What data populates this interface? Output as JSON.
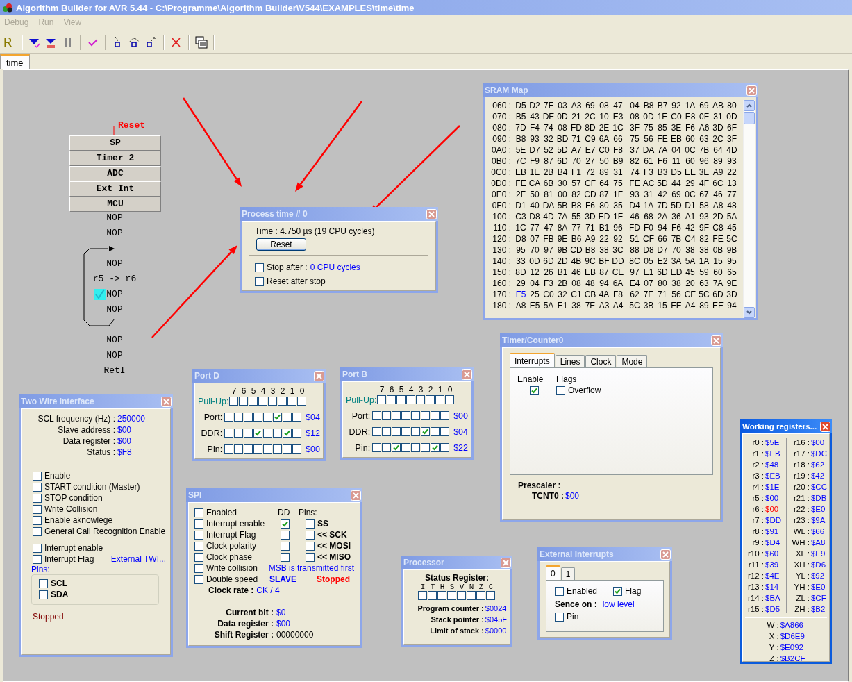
{
  "window": {
    "title": "Algorithm Builder for AVR 5.44 - C:\\Programme\\Algorithm Builder\\V544\\EXAMPLES\\time\\time"
  },
  "menu": [
    {
      "label": "Debug",
      "disabled": true
    },
    {
      "label": "Run",
      "disabled": true
    },
    {
      "label": "View",
      "disabled": true
    }
  ],
  "toolbar": {
    "logo": "R"
  },
  "tabs": [
    {
      "label": "time",
      "selected": true
    }
  ],
  "flowchart": {
    "start": "Reset",
    "blocks": [
      "SP",
      "Timer 2",
      "ADC",
      "Ext Int",
      "MCU"
    ],
    "nodes": [
      {
        "text": "NOP",
        "marked": false
      },
      {
        "text": "NOP",
        "marked": false
      },
      {
        "text": "NOP",
        "marked": false
      },
      {
        "text": "r5 -> r6",
        "marked": false
      },
      {
        "text": "NOP",
        "marked": true
      },
      {
        "text": "NOP",
        "marked": false
      },
      {
        "text": "NOP",
        "marked": false
      },
      {
        "text": "NOP",
        "marked": false
      },
      {
        "text": "RetI",
        "marked": false
      }
    ]
  },
  "process_time": {
    "title": "Process time # 0",
    "active": false,
    "time": "Time :  4.750 µs (19 CPU cycles)",
    "reset_button": "Reset",
    "options": [
      {
        "label": "Stop after :",
        "link": "0 CPU cycles",
        "checked": false
      },
      {
        "label": "Reset after stop",
        "checked": false
      }
    ]
  },
  "sram_map": {
    "title": "SRAM Map",
    "active": false,
    "rows": [
      {
        "address": "060 :",
        "bytes": [
          "D5",
          "D2",
          "7F",
          "03",
          "A3",
          "69",
          "08",
          "47",
          "04",
          "B8",
          "B7",
          "92",
          "1A",
          "69",
          "AB",
          "80"
        ]
      },
      {
        "address": "070 :",
        "bytes": [
          "B5",
          "43",
          "DE",
          "0D",
          "21",
          "2C",
          "10",
          "E3",
          "08",
          "0D",
          "1E",
          "C0",
          "E8",
          "0F",
          "31",
          "0D"
        ]
      },
      {
        "address": "080 :",
        "bytes": [
          "7D",
          "F4",
          "74",
          "08",
          "FD",
          "8D",
          "2E",
          "1C",
          "3F",
          "75",
          "85",
          "3E",
          "F6",
          "A6",
          "3D",
          "6F"
        ]
      },
      {
        "address": "090 :",
        "bytes": [
          "B8",
          "93",
          "32",
          "BD",
          "71",
          "C9",
          "6A",
          "66",
          "75",
          "56",
          "FE",
          "EB",
          "60",
          "63",
          "2C",
          "3F"
        ]
      },
      {
        "address": "0A0 :",
        "bytes": [
          "5E",
          "D7",
          "52",
          "5D",
          "A7",
          "E7",
          "C0",
          "F8",
          "37",
          "DA",
          "7A",
          "04",
          "0C",
          "7B",
          "64",
          "4D"
        ]
      },
      {
        "address": "0B0 :",
        "bytes": [
          "7C",
          "F9",
          "87",
          "6D",
          "70",
          "27",
          "50",
          "B9",
          "82",
          "61",
          "F6",
          "11",
          "60",
          "96",
          "89",
          "93"
        ]
      },
      {
        "address": "0C0 :",
        "bytes": [
          "EB",
          "1E",
          "2B",
          "B4",
          "F1",
          "72",
          "89",
          "31",
          "74",
          "F3",
          "B3",
          "D5",
          "EE",
          "3E",
          "A9",
          "22"
        ]
      },
      {
        "address": "0D0 :",
        "bytes": [
          "FE",
          "CA",
          "6B",
          "30",
          "57",
          "CF",
          "64",
          "75",
          "FE",
          "AC",
          "5D",
          "44",
          "29",
          "4F",
          "6C",
          "13"
        ]
      },
      {
        "address": "0E0 :",
        "bytes": [
          "2F",
          "50",
          "81",
          "00",
          "82",
          "CD",
          "87",
          "1F",
          "93",
          "31",
          "42",
          "69",
          "0C",
          "67",
          "46",
          "77"
        ]
      },
      {
        "address": "0F0 :",
        "bytes": [
          "D1",
          "40",
          "DA",
          "5B",
          "B8",
          "F6",
          "80",
          "35",
          "D4",
          "1A",
          "7D",
          "5D",
          "D1",
          "58",
          "A8",
          "48"
        ]
      },
      {
        "address": "100 :",
        "bytes": [
          "C3",
          "D8",
          "4D",
          "7A",
          "55",
          "3D",
          "ED",
          "1F",
          "46",
          "68",
          "2A",
          "36",
          "A1",
          "93",
          "2D",
          "5A"
        ]
      },
      {
        "address": "110 :",
        "bytes": [
          "1C",
          "77",
          "47",
          "8A",
          "77",
          "71",
          "B1",
          "96",
          "FD",
          "F0",
          "94",
          "F6",
          "42",
          "9F",
          "C8",
          "45"
        ]
      },
      {
        "address": "120 :",
        "bytes": [
          "D8",
          "07",
          "FB",
          "9E",
          "B6",
          "A9",
          "22",
          "92",
          "51",
          "CF",
          "66",
          "7B",
          "C4",
          "82",
          "FE",
          "5C"
        ]
      },
      {
        "address": "130 :",
        "bytes": [
          "95",
          "70",
          "97",
          "9B",
          "CD",
          "B8",
          "38",
          "3C",
          "88",
          "D8",
          "D7",
          "70",
          "38",
          "38",
          "0B",
          "9B"
        ]
      },
      {
        "address": "140 :",
        "bytes": [
          "33",
          "0D",
          "6D",
          "2D",
          "4B",
          "9C",
          "BF",
          "DD",
          "8C",
          "05",
          "E2",
          "3A",
          "5A",
          "1A",
          "15",
          "95"
        ]
      },
      {
        "address": "150 :",
        "bytes": [
          "8D",
          "12",
          "26",
          "B1",
          "46",
          "EB",
          "87",
          "CE",
          "97",
          "E1",
          "6D",
          "ED",
          "45",
          "59",
          "60",
          "65"
        ]
      },
      {
        "address": "160 :",
        "bytes": [
          "29",
          "04",
          "F3",
          "2B",
          "08",
          "48",
          "94",
          "6A",
          "E4",
          "07",
          "80",
          "38",
          "20",
          "63",
          "7A",
          "9E"
        ]
      },
      {
        "address": "170 :",
        "bytes": [
          "E5",
          "25",
          "C0",
          "32",
          "C1",
          "CB",
          "4A",
          "F8",
          "62",
          "7E",
          "71",
          "56",
          "CE",
          "5C",
          "6D",
          "3D"
        ],
        "changed": [
          true,
          false,
          false,
          false,
          false,
          false,
          false,
          false,
          false,
          false,
          false,
          false,
          false,
          false,
          false,
          false
        ]
      },
      {
        "address": "180 :",
        "bytes": [
          "A8",
          "E5",
          "5A",
          "E1",
          "38",
          "7E",
          "A3",
          "A4",
          "5C",
          "3B",
          "15",
          "FE",
          "A4",
          "89",
          "EE",
          "94"
        ]
      }
    ]
  },
  "timer0": {
    "title": "Timer/Counter0",
    "active": false,
    "tabs": [
      {
        "label": "Interrupts",
        "selected": true
      },
      {
        "label": "Lines",
        "selected": false
      },
      {
        "label": "Clock",
        "selected": false
      },
      {
        "label": "Mode",
        "selected": false
      }
    ],
    "enable_header": "Enable",
    "flags_header": "Flags",
    "enable_checked": true,
    "flags": [
      {
        "label": "Overflow",
        "checked": false
      }
    ],
    "prescaler_label": "Prescaler :",
    "counter": {
      "label": "TCNT0 :",
      "value": "$00"
    }
  },
  "working_registers": {
    "title": "Working registers...",
    "active": true,
    "left": [
      {
        "name": "r0 :",
        "value": "$5E",
        "changed": false
      },
      {
        "name": "r1 :",
        "value": "$EB",
        "changed": false
      },
      {
        "name": "r2 :",
        "value": "$48",
        "changed": false
      },
      {
        "name": "r3 :",
        "value": "$EB",
        "changed": false
      },
      {
        "name": "r4 :",
        "value": "$1E",
        "changed": false
      },
      {
        "name": "r5 :",
        "value": "$00",
        "changed": false
      },
      {
        "name": "r6 :",
        "value": "$00",
        "changed": true
      },
      {
        "name": "r7 :",
        "value": "$DD",
        "changed": false
      },
      {
        "name": "r8 :",
        "value": "$91",
        "changed": false
      },
      {
        "name": "r9 :",
        "value": "$D4",
        "changed": false
      },
      {
        "name": "r10 :",
        "value": "$60",
        "changed": false
      },
      {
        "name": "r11 :",
        "value": "$39",
        "changed": false
      },
      {
        "name": "r12 :",
        "value": "$4E",
        "changed": false
      },
      {
        "name": "r13 :",
        "value": "$14",
        "changed": false
      },
      {
        "name": "r14 :",
        "value": "$BA",
        "changed": false
      },
      {
        "name": "r15 :",
        "value": "$D5",
        "changed": false
      }
    ],
    "right": [
      {
        "name": "r16 :",
        "value": "$00",
        "changed": false
      },
      {
        "name": "r17 :",
        "value": "$DC",
        "changed": false
      },
      {
        "name": "r18 :",
        "value": "$62",
        "changed": false
      },
      {
        "name": "r19 :",
        "value": "$42",
        "changed": false
      },
      {
        "name": "r20 :",
        "value": "$CC",
        "changed": false
      },
      {
        "name": "r21 :",
        "value": "$DB",
        "changed": false
      },
      {
        "name": "r22 :",
        "value": "$E0",
        "changed": false
      },
      {
        "name": "r23 :",
        "value": "$9A",
        "changed": false
      },
      {
        "name": "WL :",
        "value": "$66",
        "changed": false
      },
      {
        "name": "WH :",
        "value": "$A8",
        "changed": false
      },
      {
        "name": "XL :",
        "value": "$E9",
        "changed": false
      },
      {
        "name": "XH :",
        "value": "$D6",
        "changed": false
      },
      {
        "name": "YL :",
        "value": "$92",
        "changed": false
      },
      {
        "name": "YH :",
        "value": "$E0",
        "changed": false
      },
      {
        "name": "ZL :",
        "value": "$CF",
        "changed": false
      },
      {
        "name": "ZH :",
        "value": "$B2",
        "changed": false
      }
    ],
    "pairs": [
      {
        "name": "W :",
        "value": "$A866"
      },
      {
        "name": "X :",
        "value": "$D6E9"
      },
      {
        "name": "Y :",
        "value": "$E092"
      },
      {
        "name": "Z :",
        "value": "$B2CF"
      }
    ]
  },
  "external_interrupts": {
    "title": "External Interrupts",
    "active": false,
    "tabs": [
      {
        "label": "0",
        "selected": true
      },
      {
        "label": "1",
        "selected": false
      }
    ],
    "enabled": {
      "label": "Enabled",
      "checked": false
    },
    "flag": {
      "label": "Flag",
      "checked": true
    },
    "sense_label": "Sence on :",
    "sense_value": "low level",
    "pin": {
      "label": "Pin",
      "checked": false
    }
  },
  "processor": {
    "title": "Processor",
    "active": false,
    "status_label": "Status Register:",
    "status_bits": [
      {
        "label": "I",
        "checked": false
      },
      {
        "label": "T",
        "checked": false
      },
      {
        "label": "H",
        "checked": false
      },
      {
        "label": "S",
        "checked": false
      },
      {
        "label": "V",
        "checked": false
      },
      {
        "label": "N",
        "checked": false
      },
      {
        "label": "Z",
        "checked": false
      },
      {
        "label": "C",
        "checked": false
      }
    ],
    "fields": [
      {
        "label": "Program counter :",
        "value": "$0024"
      },
      {
        "label": "Stack pointer :",
        "value": "$045F"
      },
      {
        "label": "Limit of stack :",
        "value": "$0000"
      }
    ]
  },
  "spi": {
    "title": "SPI",
    "active": false,
    "flags": [
      {
        "label": "Enabled",
        "checked": false
      },
      {
        "label": "Interrupt enable",
        "checked": false
      },
      {
        "label": "Interrupt Flag",
        "checked": false
      },
      {
        "label": "Clock polarity",
        "checked": false
      },
      {
        "label": "Clock phase",
        "checked": false
      },
      {
        "label": "Write collision",
        "checked": false
      },
      {
        "label": "Double speed",
        "checked": false
      }
    ],
    "dd_header": "DD",
    "pins_header": "Pins:",
    "dd": [
      {
        "checked": true
      },
      {
        "checked": false
      },
      {
        "checked": false
      },
      {
        "checked": false
      }
    ],
    "pins": [
      {
        "label": "SS",
        "checked": false
      },
      {
        "label": "<< SCK",
        "checked": false
      },
      {
        "label": "<< MOSI",
        "checked": false
      },
      {
        "label": "<< MISO",
        "checked": false
      }
    ],
    "bit_order": "MSB is transmitted first",
    "mode": "SLAVE",
    "state": "Stopped",
    "clock_rate": {
      "label": "Clock rate :",
      "value": "CK / 4"
    },
    "registers": [
      {
        "label": "Current bit :",
        "value": "$0",
        "kind": "hex"
      },
      {
        "label": "Data register :",
        "value": "$00",
        "kind": "hex"
      },
      {
        "label": "Shift Register :",
        "value": "00000000",
        "kind": "binary"
      }
    ]
  },
  "port_d": {
    "title": "Port D",
    "active": false,
    "bit_labels": [
      "7",
      "6",
      "5",
      "4",
      "3",
      "2",
      "1",
      "0"
    ],
    "rows": [
      {
        "label": "Pull-Up:",
        "kind": "pullup",
        "bits": [
          false,
          false,
          false,
          false,
          false,
          false,
          false,
          false
        ]
      },
      {
        "label": "Port:",
        "kind": "register",
        "bits": [
          false,
          false,
          false,
          false,
          false,
          true,
          false,
          false
        ],
        "value": "$04"
      },
      {
        "label": "DDR:",
        "kind": "register",
        "bits": [
          false,
          false,
          false,
          true,
          false,
          false,
          true,
          false
        ],
        "value": "$12"
      },
      {
        "label": "Pin:",
        "kind": "register",
        "bits": [
          false,
          false,
          false,
          false,
          false,
          false,
          false,
          false
        ],
        "value": "$00"
      }
    ]
  },
  "port_b": {
    "title": "Port B",
    "active": false,
    "bit_labels": [
      "7",
      "6",
      "5",
      "4",
      "3",
      "2",
      "1",
      "0"
    ],
    "rows": [
      {
        "label": "Pull-Up:",
        "kind": "pullup",
        "bits": [
          false,
          false,
          false,
          false,
          false,
          false,
          false,
          false
        ]
      },
      {
        "label": "Port:",
        "kind": "register",
        "bits": [
          false,
          false,
          false,
          false,
          false,
          false,
          false,
          false
        ],
        "value": "$00"
      },
      {
        "label": "DDR:",
        "kind": "register",
        "bits": [
          false,
          false,
          false,
          false,
          false,
          true,
          false,
          false
        ],
        "value": "$04"
      },
      {
        "label": "Pin:",
        "kind": "register",
        "bits": [
          false,
          false,
          true,
          false,
          false,
          false,
          true,
          false
        ],
        "value": "$22"
      }
    ]
  },
  "twi": {
    "title": "Two Wire Interface",
    "active": false,
    "fields": [
      {
        "label": "SCL frequency (Hz) :",
        "value": "250000"
      },
      {
        "label": "Slave address :",
        "value": "$00"
      },
      {
        "label": "Data register :",
        "value": "$00"
      },
      {
        "label": "Status :",
        "value": "$F8"
      }
    ],
    "controls": [
      {
        "label": "Enable",
        "checked": false
      },
      {
        "label": "START condition (Master)",
        "checked": false
      },
      {
        "label": "STOP condition",
        "checked": false
      },
      {
        "label": "Write Collision",
        "checked": false
      },
      {
        "label": "Enable aknowlege",
        "checked": false
      },
      {
        "label": "General Call Recognition Enable",
        "checked": false
      }
    ],
    "interrupts": [
      {
        "label": "Interrupt enable",
        "checked": false
      },
      {
        "label": "Interrupt Flag",
        "checked": false
      }
    ],
    "external_link": "External TWI...",
    "pins_label": "Pins:",
    "pins": [
      {
        "label": "SCL",
        "checked": false
      },
      {
        "label": "SDA",
        "checked": false
      }
    ],
    "state": "Stopped"
  }
}
